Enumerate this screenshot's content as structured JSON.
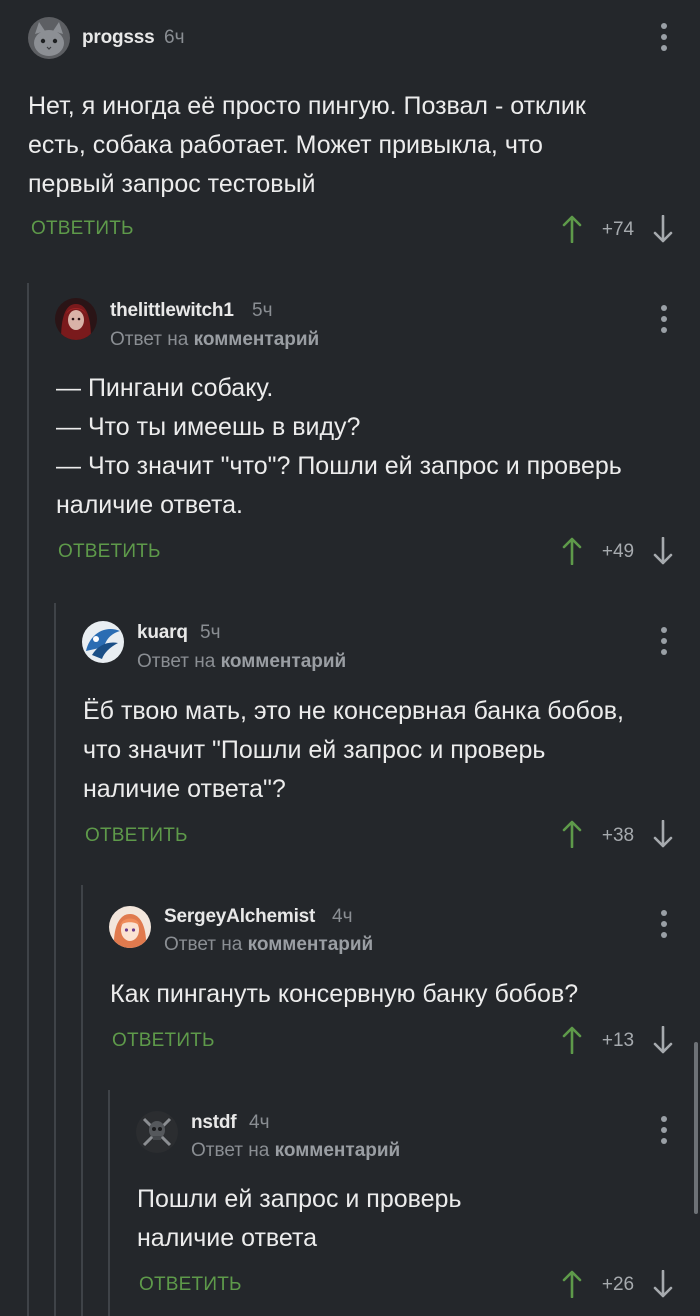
{
  "colors": {
    "background": "#24272b",
    "reply_action": "#5e9a4a",
    "upvote_arrow": "#5e9a4a",
    "muted_text": "#8a8e93",
    "thread_line": "#3f4348"
  },
  "reply_label": "ОТВЕТИТЬ",
  "comments": [
    {
      "username": "progsss",
      "time": "6ч",
      "reply_to": null,
      "text": "Нет, я иногда её просто пингую. Позвал - отклик\nесть, собака работает. Может привыкла, что\nпервый запрос тестовый",
      "score": "+74",
      "avatar_icon": "grey-cat-avatar"
    },
    {
      "username": "thelittlewitch1",
      "time": "5ч",
      "reply_to": {
        "prefix": "Ответ на",
        "target": "комментарий"
      },
      "text": "— Пингани собаку.\n— Что ты имеешь в виду?\n— Что значит \"что\"? Пошли ей запрос и проверь\nналичие ответа.",
      "score": "+49",
      "avatar_icon": "red-haired-character-avatar"
    },
    {
      "username": "kuarq",
      "time": "5ч",
      "reply_to": {
        "prefix": "Ответ на",
        "target": "комментарий"
      },
      "text": "Ёб твою мать, это не консервная банка бобов,\nчто значит \"Пошли ей запрос и проверь\nналичие ответа\"?",
      "score": "+38",
      "avatar_icon": "blue-emblem-avatar"
    },
    {
      "username": "SergeyAlchemist",
      "time": "4ч",
      "reply_to": {
        "prefix": "Ответ на",
        "target": "комментарий"
      },
      "text": "Как пингануть консервную банку бобов?",
      "score": "+13",
      "avatar_icon": "anime-girl-avatar"
    },
    {
      "username": "nstdf",
      "time": "4ч",
      "reply_to": {
        "prefix": "Ответ на",
        "target": "комментарий"
      },
      "text": "Пошли ей запрос и проверь\nналичие ответа",
      "score": "+26",
      "avatar_icon": "dark-skull-avatar"
    }
  ]
}
